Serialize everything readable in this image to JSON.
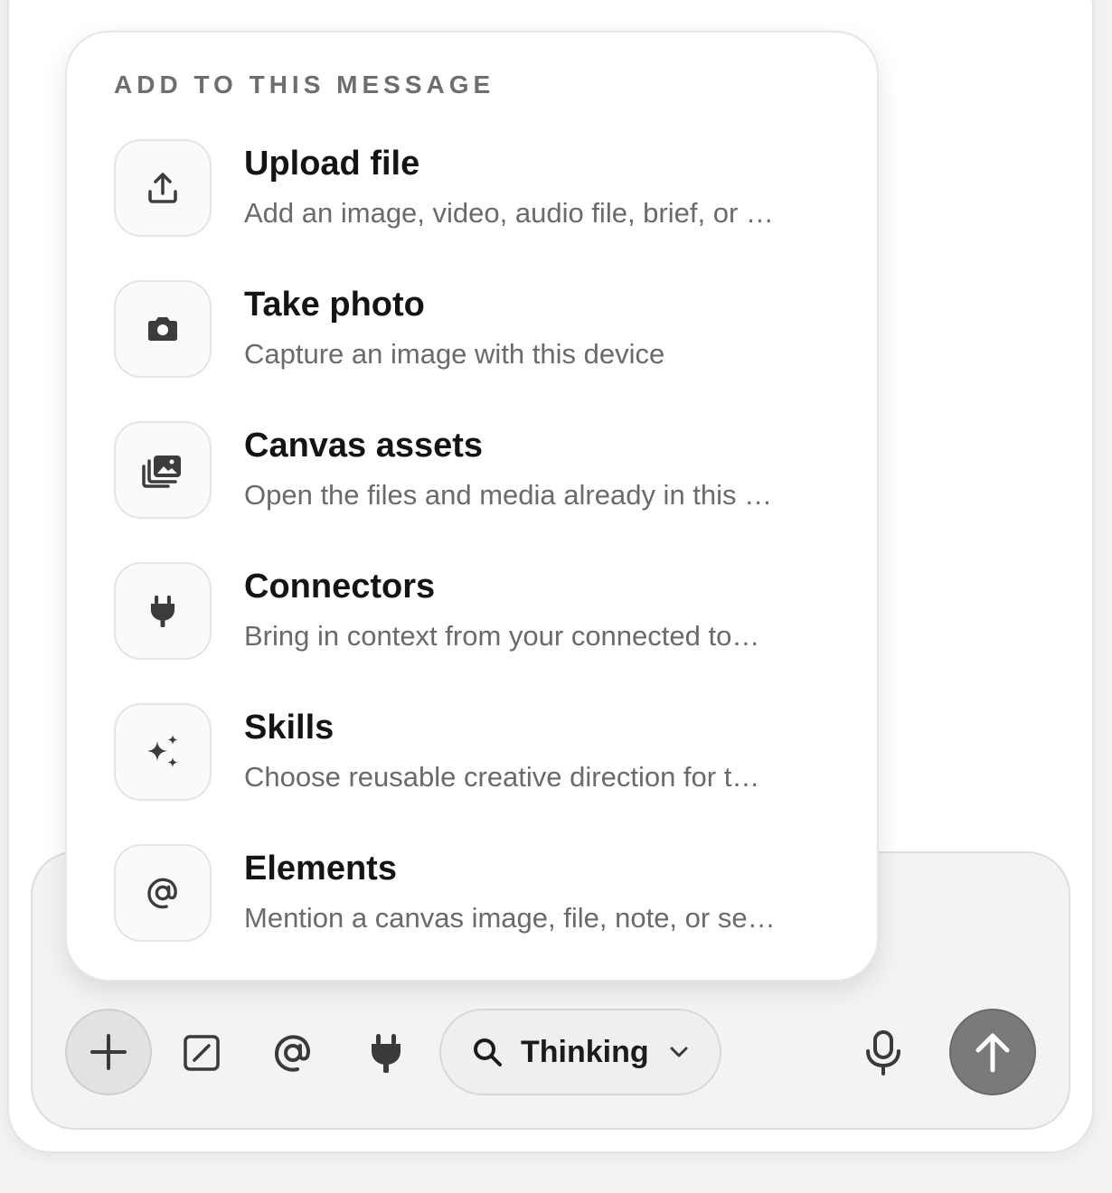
{
  "menu": {
    "heading": "ADD TO THIS MESSAGE",
    "items": [
      {
        "title": "Upload file",
        "description": "Add an image, video, audio file, brief, or …",
        "icon": "upload-icon"
      },
      {
        "title": "Take photo",
        "description": "Capture an image with this device",
        "icon": "camera-icon"
      },
      {
        "title": "Canvas assets",
        "description": "Open the files and media already in this …",
        "icon": "images-icon"
      },
      {
        "title": "Connectors",
        "description": "Bring in context from your connected to…",
        "icon": "plug-icon"
      },
      {
        "title": "Skills",
        "description": "Choose reusable creative direction for t…",
        "icon": "sparkles-icon"
      },
      {
        "title": "Elements",
        "description": "Mention a canvas image, file, note, or se…",
        "icon": "at-icon"
      }
    ]
  },
  "toolbar": {
    "mode_label": "Thinking",
    "icons": [
      "plus-icon",
      "slash-icon",
      "at-icon",
      "plug-icon",
      "search-icon",
      "chevron-down-icon",
      "mic-icon",
      "arrow-up-icon"
    ]
  },
  "colors": {
    "send_button": "#7a7a7a",
    "menu_background": "#ffffff",
    "composer_background": "#f3f3f3"
  }
}
